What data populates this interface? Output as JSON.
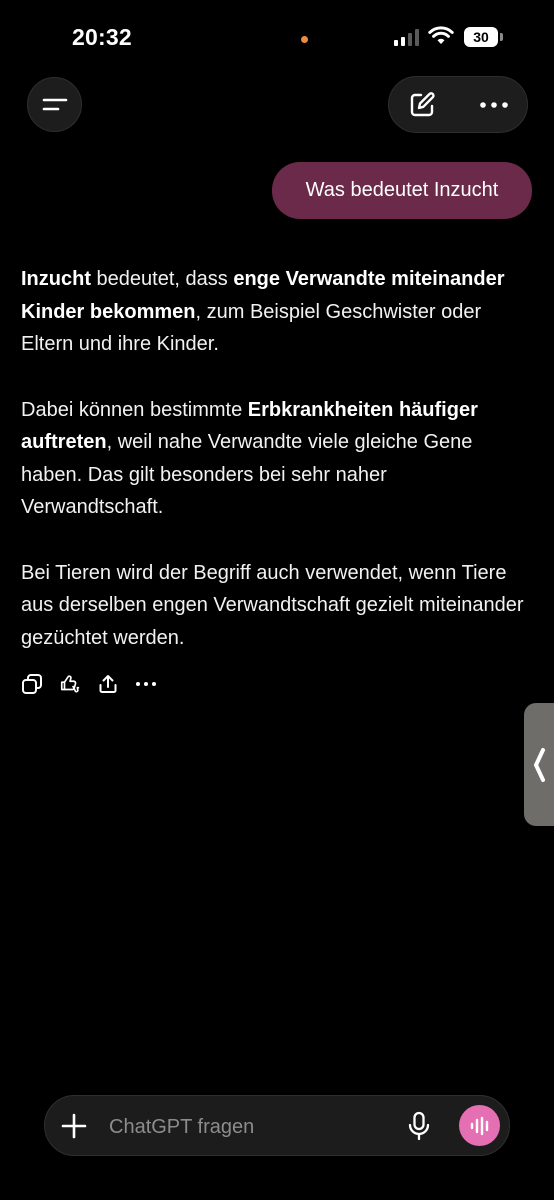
{
  "status_bar": {
    "time": "20:32",
    "battery": "30",
    "recording_dot_color": "#f08a3c"
  },
  "header": {
    "menu_icon": "menu-icon",
    "new_chat_icon": "compose-icon",
    "more_icon": "more-dots-icon"
  },
  "conversation": {
    "user_message": "Was bedeutet Inzucht",
    "user_bubble_color": "#6b2a49",
    "assistant": {
      "p1_b1": "Inzucht",
      "p1_t1": " bedeutet, dass ",
      "p1_b2": "enge Verwandte miteinan­der Kinder bekommen",
      "p1_t2": ", zum Beispiel Geschwister oder Eltern und ihre Kinder.",
      "p2_t1": "Dabei können bestimmte ",
      "p2_b1": "Erbkrankheiten häufiger auftreten",
      "p2_t2": ", weil nahe Verwandte viele gleiche Gene haben. Das gilt besonders bei sehr naher Verwandtschaft.",
      "p3": "Bei Tieren wird der Begriff auch verwendet, wenn Tiere aus derselben engen Verwandtschaft gezielt miteinander gezüchtet werden."
    },
    "action_icons": [
      "copy-icon",
      "thumbs-icon",
      "share-icon",
      "more-dots-icon"
    ]
  },
  "composer": {
    "placeholder": "ChatGPT fragen",
    "voice_button_color": "#e56fb3"
  }
}
